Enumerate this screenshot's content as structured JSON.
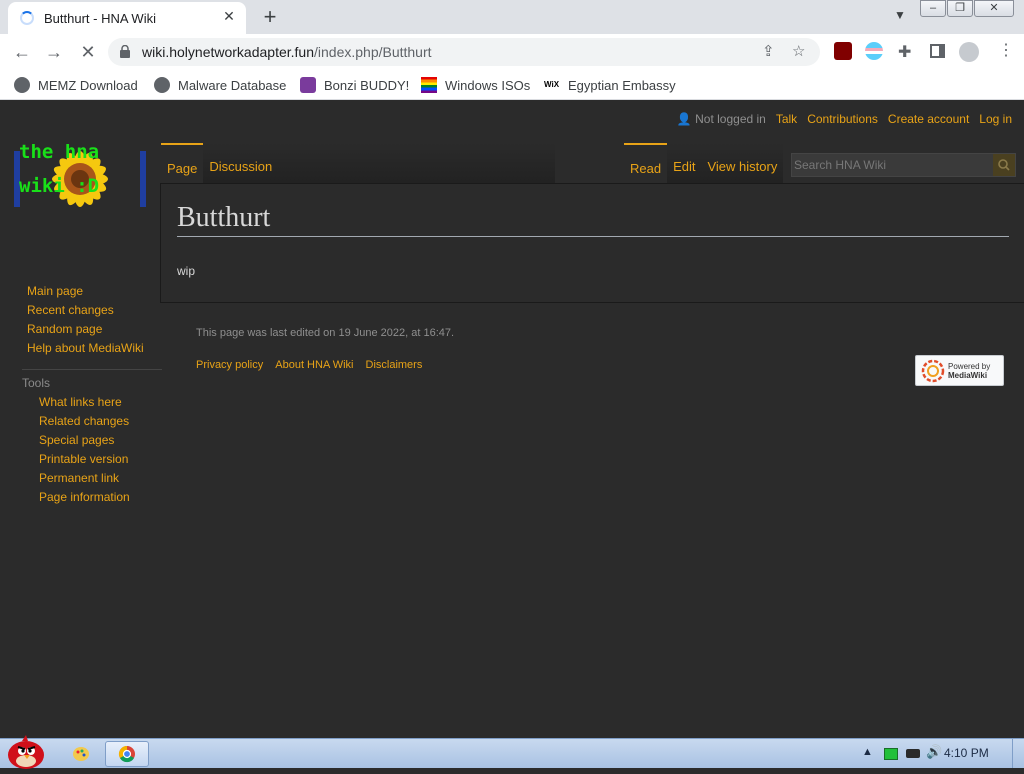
{
  "browser": {
    "tab_title": "Butthurt - HNA Wiki",
    "url_host": "wiki.holynetworkadapter.fun",
    "url_path": "/index.php/Butthurt",
    "bookmarks": [
      {
        "label": "MEMZ Download"
      },
      {
        "label": "Malware Database"
      },
      {
        "label": "Bonzi BUDDY!"
      },
      {
        "label": "Windows ISOs"
      },
      {
        "label": "Egyptian Embassy"
      }
    ]
  },
  "wiki": {
    "logo_line1": "the hna",
    "logo_line2": "wiki :D",
    "personal": {
      "not_logged_in": "Not logged in",
      "talk": "Talk",
      "contributions": "Contributions",
      "create_account": "Create account",
      "log_in": "Log in"
    },
    "tabs_left": [
      {
        "label": "Page"
      },
      {
        "label": "Discussion"
      }
    ],
    "tabs_right": [
      {
        "label": "Read"
      },
      {
        "label": "Edit"
      },
      {
        "label": "View history"
      }
    ],
    "search_placeholder": "Search HNA Wiki",
    "heading": "Butthurt",
    "body": "wip",
    "navigation": [
      {
        "label": "Main page"
      },
      {
        "label": "Recent changes"
      },
      {
        "label": "Random page"
      },
      {
        "label": "Help about MediaWiki"
      }
    ],
    "tools_heading": "Tools",
    "tools": [
      {
        "label": "What links here"
      },
      {
        "label": "Related changes"
      },
      {
        "label": "Special pages"
      },
      {
        "label": "Printable version"
      },
      {
        "label": "Permanent link"
      },
      {
        "label": "Page information"
      }
    ],
    "last_edited": "This page was last edited on 19 June 2022, at 16:47.",
    "footer_links": [
      {
        "label": "Privacy policy"
      },
      {
        "label": "About HNA Wiki"
      },
      {
        "label": "Disclaimers"
      }
    ],
    "powered_by_line1": "Powered by",
    "powered_by_line2": "MediaWiki"
  },
  "taskbar": {
    "time": "4:10 PM"
  },
  "colors": {
    "link": "#e8a317",
    "page_bg": "#2b2b2b",
    "logo_text": "#19e019"
  }
}
